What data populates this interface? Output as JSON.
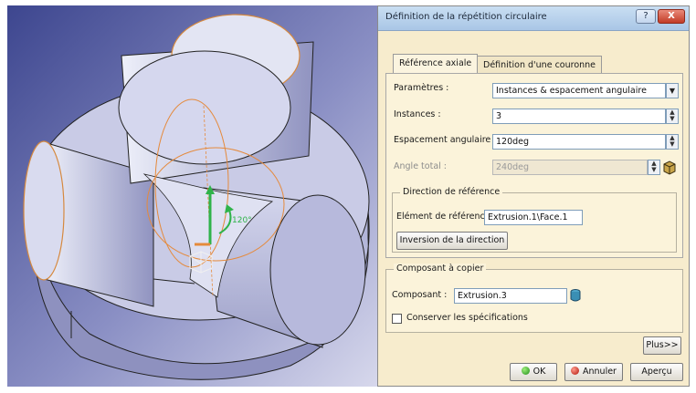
{
  "dialog": {
    "title": "Définition de la répétition circulaire",
    "window_buttons": {
      "help": "?",
      "close": "X"
    },
    "tabs": [
      {
        "label": "Référence axiale",
        "active": true
      },
      {
        "label": "Définition d'une couronne",
        "active": false
      }
    ],
    "parametres": {
      "label": "Paramètres :",
      "value": "Instances & espacement angulaire"
    },
    "instances": {
      "label": "Instances :",
      "value": "3"
    },
    "espacement": {
      "label": "Espacement angulaire :",
      "value": "120deg"
    },
    "angle_total": {
      "label": "Angle total :",
      "value": "240deg"
    },
    "direction": {
      "title": "Direction de référence",
      "element_label": "Elément de référence:",
      "element_value": "Extrusion.1\\Face.1",
      "inversion_button": "Inversion de la direction"
    },
    "composant": {
      "title": "Composant à copier",
      "label": "Composant :",
      "value": "Extrusion.3",
      "conserver_label": "Conserver les spécifications",
      "conserver_checked": false
    },
    "plus_button": "Plus>>",
    "ok_button": "OK",
    "annuler_button": "Annuler",
    "apercu_button": "Aperçu"
  },
  "viewport": {
    "angle_annotation": "120°",
    "colors": {
      "background": "#4a54a0",
      "part_face": "#b9bbd9",
      "part_top": "#d9dbee",
      "highlight": "#e58a3c",
      "axis_green": "#2fb34a"
    }
  }
}
